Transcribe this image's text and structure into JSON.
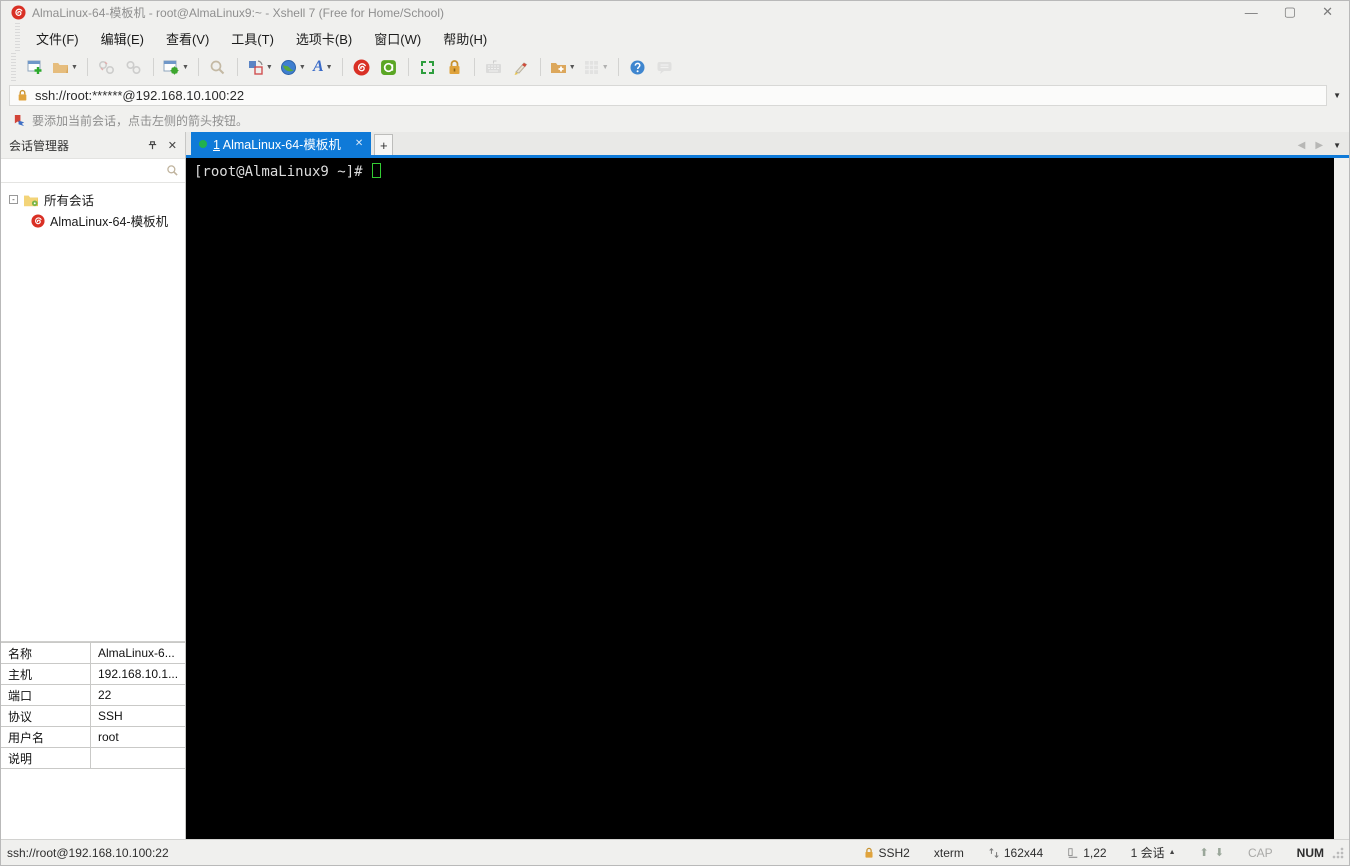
{
  "window": {
    "title": "AlmaLinux-64-模板机 - root@AlmaLinux9:~ - Xshell 7 (Free for Home/School)"
  },
  "icons": {
    "minimize": "—",
    "maximize": "▢",
    "close": "✕",
    "plus": "+",
    "collapse_minus": "-",
    "dropdown": "▼",
    "nav_left": "◀",
    "nav_right": "▶",
    "up_triangle": "▲",
    "up_arrow": "⬆",
    "down_arrow": "⬇",
    "search": "⌕"
  },
  "menu": {
    "items": [
      {
        "label": "文件(F)"
      },
      {
        "label": "编辑(E)"
      },
      {
        "label": "查看(V)"
      },
      {
        "label": "工具(T)"
      },
      {
        "label": "选项卡(B)"
      },
      {
        "label": "窗口(W)"
      },
      {
        "label": "帮助(H)"
      }
    ]
  },
  "addressbar": {
    "url": "ssh://root:******@192.168.10.100:22"
  },
  "infobar": {
    "text": "要添加当前会话，点击左侧的箭头按钮。"
  },
  "session_manager": {
    "title": "会话管理器",
    "search_value": "",
    "tree": {
      "root_label": "所有会话",
      "session_label": "AlmaLinux-64-模板机"
    }
  },
  "tabs": {
    "active": {
      "index": "1",
      "label": "AlmaLinux-64-模板机"
    }
  },
  "terminal": {
    "prompt": "[root@AlmaLinux9 ~]# "
  },
  "properties": {
    "rows": [
      {
        "label": "名称",
        "value": "AlmaLinux-6..."
      },
      {
        "label": "主机",
        "value": "192.168.10.1..."
      },
      {
        "label": "端口",
        "value": "22"
      },
      {
        "label": "协议",
        "value": "SSH"
      },
      {
        "label": "用户名",
        "value": "root"
      },
      {
        "label": "说明",
        "value": ""
      }
    ]
  },
  "statusbar": {
    "url": "ssh://root@192.168.10.100:22",
    "protocol": "SSH2",
    "term_type": "xterm",
    "size": "162x44",
    "cursor_pos": "1,22",
    "session_count": "1 会话",
    "cap": "CAP",
    "num": "NUM"
  },
  "colors": {
    "tab_active": "#0f7ad8",
    "tab_dot_green": "#22b14c",
    "terminal_bg": "#000000",
    "terminal_fg": "#dcdcdc",
    "cursor_green": "#33cc33",
    "xshell_red": "#d93025",
    "xftp_green": "#5aa624",
    "lock_gold": "#e0a33c"
  }
}
